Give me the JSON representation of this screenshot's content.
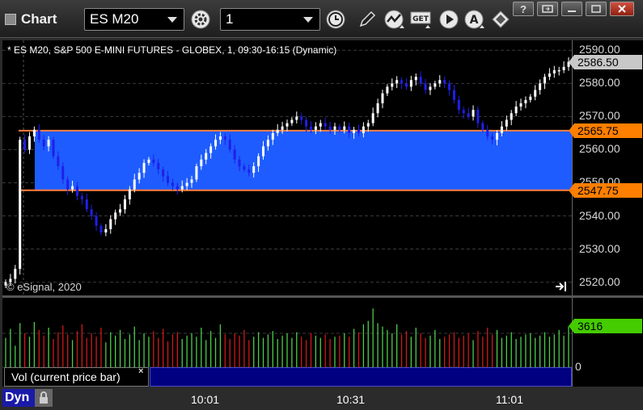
{
  "window": {
    "title": "Chart",
    "symbol": "ES M20",
    "interval": "1",
    "buttons": [
      "minimize",
      "restore",
      "maximize",
      "close"
    ]
  },
  "toolbar": {
    "icons": [
      "gear-icon",
      "clock-icon",
      "pencil-icon",
      "study-icon",
      "get-icon",
      "play-icon",
      "alert-icon",
      "link-icon"
    ]
  },
  "chart": {
    "description": "* ES M20, S&P 500 E-MINI FUTURES - GLOBEX, 1, 09:30-16:15 (Dynamic)",
    "copyright": "© eSignal, 2020",
    "mode": "Dyn",
    "volume_label": "Vol (current price bar)",
    "volume_close": "×",
    "colors": {
      "up": "#ffffff",
      "down": "#1f1fe8",
      "band": "#1e5cff",
      "band_line": "#ff7f3f",
      "vol_up": "#4ccc4c",
      "vol_down": "#d01818"
    }
  },
  "chart_data": [
    {
      "type": "candlestick",
      "ylim": [
        2516,
        2593
      ],
      "yticks": [
        "2520.00",
        "2530.00",
        "2540.00",
        "2550.00",
        "2560.00",
        "2570.00",
        "2580.00",
        "2590.00"
      ],
      "xticks": [
        "10:01",
        "10:31",
        "11:01"
      ],
      "last_price": "2586.50",
      "band": {
        "upper": "2565.75",
        "lower": "2547.75"
      },
      "close_series": [
        2520,
        2521,
        2524,
        2563,
        2560,
        2564,
        2566,
        2563,
        2561,
        2563,
        2558,
        2555,
        2551,
        2548,
        2549,
        2546,
        2545,
        2542,
        2540,
        2537,
        2535,
        2536,
        2539,
        2541,
        2542,
        2545,
        2548,
        2551,
        2553,
        2556,
        2557,
        2556,
        2554,
        2552,
        2550,
        2549,
        2548,
        2549,
        2550,
        2551,
        2555,
        2557,
        2559,
        2561,
        2563,
        2564,
        2563,
        2560,
        2557,
        2555,
        2554,
        2553,
        2555,
        2558,
        2561,
        2563,
        2565,
        2566,
        2567,
        2568,
        2569,
        2570,
        2569,
        2567,
        2566,
        2567,
        2568,
        2567,
        2566,
        2567,
        2566,
        2567,
        2565,
        2566,
        2565,
        2567,
        2568,
        2571,
        2574,
        2577,
        2579,
        2580,
        2581,
        2580,
        2579,
        2581,
        2582,
        2580,
        2578,
        2579,
        2580,
        2581,
        2580,
        2578,
        2575,
        2572,
        2571,
        2570,
        2572,
        2568,
        2566,
        2564,
        2563,
        2565,
        2567,
        2569,
        2571,
        2573,
        2574,
        2575,
        2576,
        2578,
        2580,
        2582,
        2583,
        2584,
        2584,
        2585,
        2586.5
      ]
    },
    {
      "type": "bar",
      "series_name": "Vol (current price bar)",
      "ylim": [
        0,
        5000
      ],
      "yticks": [
        "0"
      ],
      "last_value": "3616",
      "values": [
        2600,
        3400,
        1900,
        3900,
        3000,
        2700,
        4000,
        3300,
        2800,
        3500,
        2500,
        3100,
        3700,
        2900,
        2400,
        3200,
        3800,
        2600,
        3000,
        2700,
        3500,
        2200,
        3100,
        2800,
        3300,
        2500,
        2900,
        3600,
        2400,
        3000,
        2700,
        3200,
        2600,
        3400,
        2300,
        2900,
        3100,
        2500,
        2800,
        3000,
        2700,
        3500,
        2400,
        3200,
        2600,
        3800,
        2900,
        2500,
        3000,
        2800,
        3300,
        2400,
        2700,
        3100,
        2600,
        2900,
        3200,
        2500,
        2800,
        3000,
        2600,
        3100,
        2700,
        2400,
        3000,
        2800,
        2600,
        2900,
        2500,
        2700,
        2800,
        3000,
        2700,
        3400,
        3100,
        3800,
        4100,
        5200,
        3900,
        3600,
        3300,
        3000,
        3800,
        2900,
        3200,
        2700,
        3500,
        3000,
        2600,
        2800,
        3300,
        2500,
        2700,
        2900,
        3100,
        2600,
        2800,
        3000,
        2400,
        3200,
        2700,
        3500,
        2900,
        3300,
        2600,
        2800,
        3100,
        2500,
        2700,
        2900,
        3000,
        2600,
        2800,
        3100,
        2700,
        2900,
        3300,
        2800,
        3616
      ]
    }
  ]
}
